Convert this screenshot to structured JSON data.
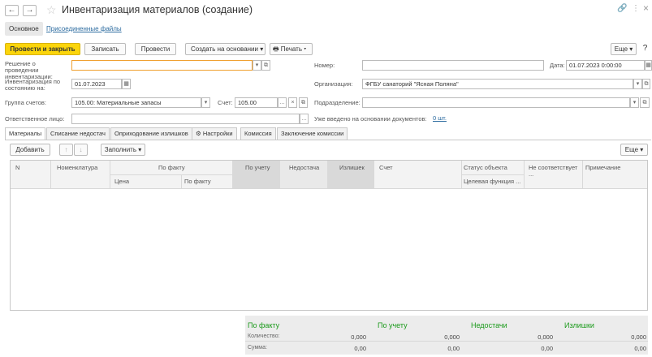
{
  "header": {
    "title": "Инвентаризация материалов (создание)",
    "back_icon": "←",
    "forward_icon": "→",
    "star_icon": "☆",
    "link_icon": "🔗",
    "menu_icon": "⋮",
    "close_icon": "×"
  },
  "sections": {
    "main": "Основное",
    "files": "Присоединенные файлы"
  },
  "toolbar": {
    "post_close": "Провести и закрыть",
    "save": "Записать",
    "post": "Провести",
    "create_based": "Создать на основании",
    "print": "Печать",
    "more": "Еще",
    "help": "?"
  },
  "form": {
    "decision_label": "Решение о проведении инвентаризации:",
    "decision_value": "",
    "number_label": "Номер:",
    "number_value": "",
    "date_label": "Дата:",
    "date_value": "01.07.2023 0:00:00",
    "state_label": "Инвентаризация по состоянию на:",
    "state_value": "01.07.2023",
    "org_label": "Организация:",
    "org_value": "ФГБУ санаторий \"Ясная Поляна\"",
    "group_label": "Группа счетов:",
    "group_value": "105.00: Материальные запасы",
    "account_label": "Счет:",
    "account_value": "105.00",
    "dept_label": "Подразделение:",
    "dept_value": "",
    "resp_label": "Ответственное лицо:",
    "resp_value": "",
    "entered_label": "Уже введено на основании документов:",
    "entered_link": "0 шт."
  },
  "tabs": [
    "Материалы",
    "Списание недостач",
    "Оприходование излишков",
    "Настройки",
    "Комиссия",
    "Заключение комиссии"
  ],
  "table_toolbar": {
    "add": "Добавить",
    "up_icon": "↑",
    "down_icon": "↓",
    "fill": "Заполнить",
    "more": "Еще"
  },
  "columns": {
    "n": "N",
    "nomenclature": "Номенклатура",
    "actual": "По факту",
    "price": "Цена",
    "actual_sub": "По факту",
    "by_account": "По учету",
    "shortage": "Недостача",
    "surplus": "Излишек",
    "account": "Счет",
    "object_status": "Статус объекта",
    "target_function": "Целевая функция ...",
    "not_matching": "Не соответствует ...",
    "note": "Примечание"
  },
  "summary": {
    "actual": "По факту",
    "by_account": "По учету",
    "shortages": "Недостачи",
    "surpluses": "Излишки",
    "qty_label": "Количество:",
    "sum_label": "Сумма:",
    "qty_actual": "0,000",
    "sum_actual": "0,00",
    "qty_account": "0,000",
    "sum_account": "0,00",
    "qty_shortage": "0,000",
    "sum_shortage": "0,00",
    "qty_surplus": "0,000",
    "sum_surplus": "0,00"
  }
}
